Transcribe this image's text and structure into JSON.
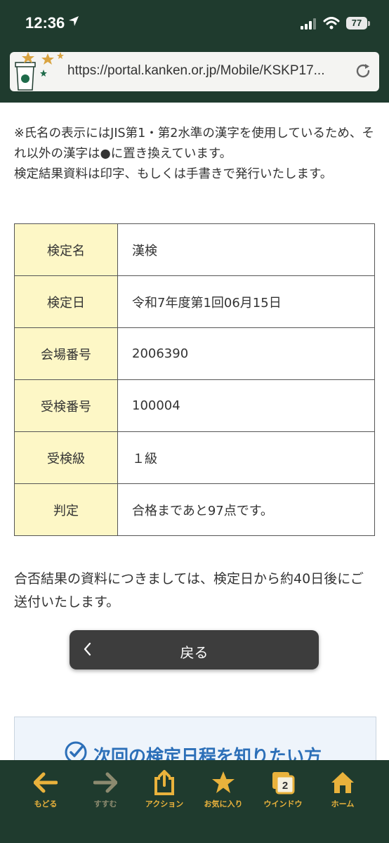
{
  "status": {
    "time": "12:36",
    "battery": "77"
  },
  "browser": {
    "url": "https://portal.kanken.or.jp/Mobile/KSKP17..."
  },
  "notice": {
    "line1": "※氏名の表示にはJIS第1・第2水準の漢字を使用しているため、それ以外の漢字は●に置き換えています。",
    "line2": "検定結果資料は印字、もしくは手書きで発行いたします。"
  },
  "result_table": [
    {
      "key": "検定名",
      "value": "漢検"
    },
    {
      "key": "検定日",
      "value": "令和7年度第1回06月15日"
    },
    {
      "key": "会場番号",
      "value": "2006390"
    },
    {
      "key": "受検番号",
      "value": "100004"
    },
    {
      "key": "受検級",
      "value": "１級"
    },
    {
      "key": "判定",
      "value": "合格まであと97点です。"
    }
  ],
  "note2": "合否結果の資料につきましては、検定日から約40日後にご送付いたします。",
  "back_button": {
    "label": "戻る"
  },
  "next_schedule": {
    "label": "次回の検定日程を知りたい方"
  },
  "toolbar": {
    "back": "もどる",
    "forward": "すすむ",
    "action": "アクション",
    "favorites": "お気に入り",
    "windows": "ウインドウ",
    "windows_count": "2",
    "home": "ホーム"
  },
  "colors": {
    "theme": "#1f3b2e",
    "key_cell": "#fdf7c6",
    "toolbar_icon": "#e9b23c",
    "link_blue": "#2c6fb8"
  }
}
